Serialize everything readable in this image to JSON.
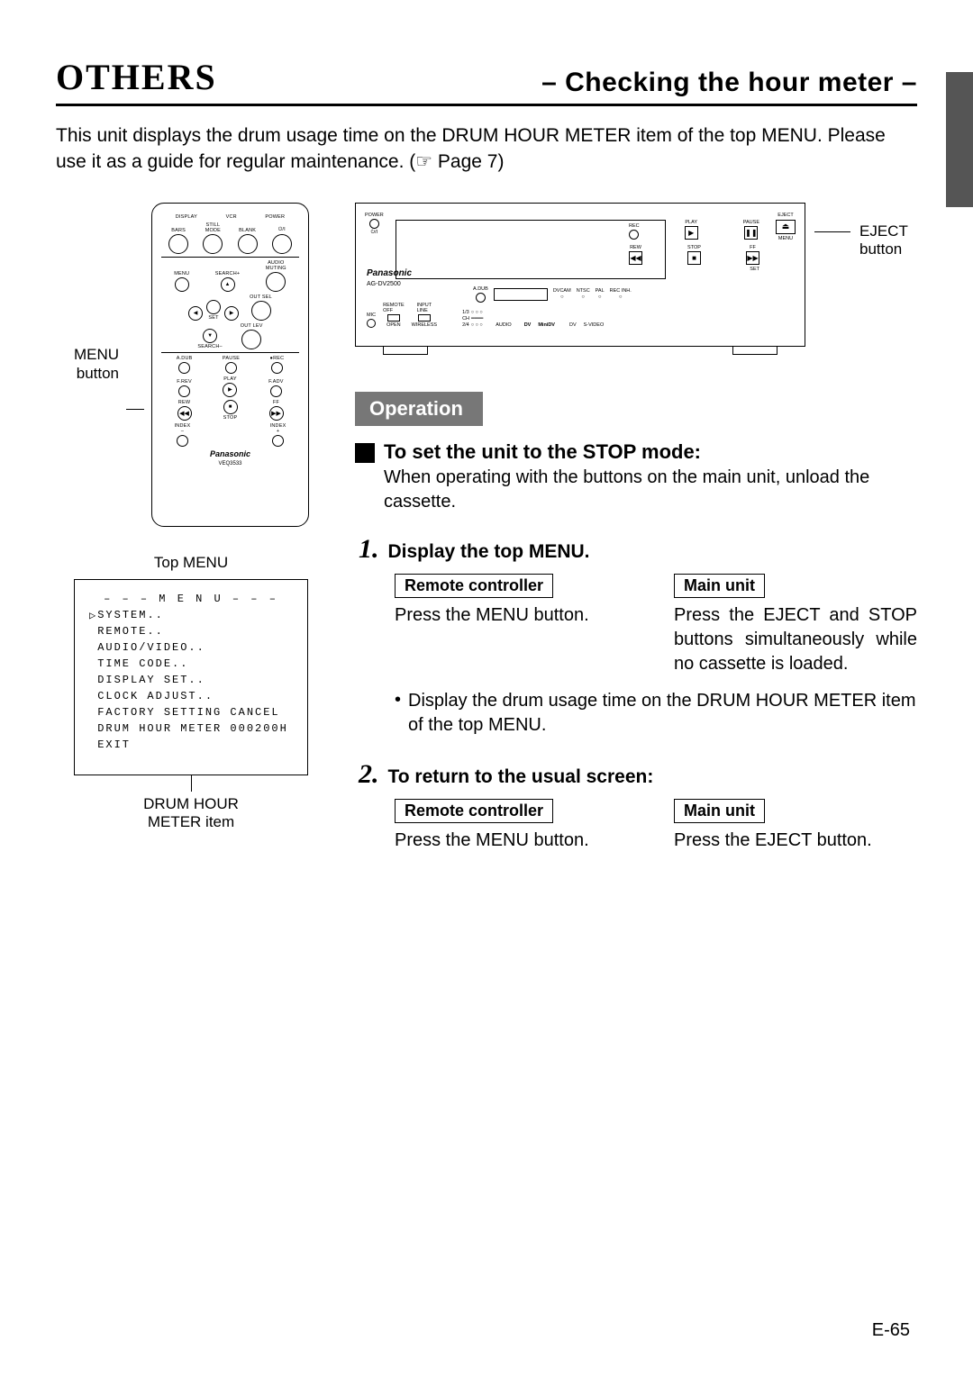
{
  "header": {
    "left": "OTHERS",
    "right": "– Checking the hour meter –"
  },
  "intro": "This unit displays the drum usage time on the DRUM HOUR METER item of the top MENU. Please use it as a guide for regular maintenance. (☞ Page 7)",
  "remote": {
    "side_label": "MENU\nbutton",
    "labels": {
      "display": "DISPLAY",
      "vcr": "VCR",
      "power": "POWER",
      "bars": "BARS",
      "still": "STILL\nMODE",
      "blank": "BLANK",
      "oi": "⏻/I",
      "menu": "MENU",
      "search_plus": "SEARCH+",
      "audio_muting": "AUDIO\nMUTING",
      "set": "SET",
      "out_sel": "OUT SEL",
      "search_minus": "SEARCH–",
      "out_lev": "OUT LEV",
      "adub": "A.DUB",
      "pause": "PAUSE",
      "rec": "REC",
      "frev": "F.REV",
      "play": "PLAY",
      "fadv": "F.ADV",
      "rew": "REW",
      "stop": "STOP",
      "ff": "FF",
      "index_minus": "INDEX\n–",
      "index_plus": "INDEX\n+"
    },
    "brand": "Panasonic",
    "model": "VEQ3533"
  },
  "top_menu": {
    "title": "Top MENU",
    "header": "– – – M E N U – – –",
    "items": [
      "SYSTEM..",
      "REMOTE..",
      "AUDIO/VIDEO..",
      "TIME CODE..",
      "DISPLAY SET..",
      "CLOCK ADJUST..",
      "FACTORY SETTING CANCEL",
      "DRUM HOUR METER 000200H",
      "EXIT"
    ],
    "pointer_label": "DRUM HOUR\nMETER item"
  },
  "deck": {
    "eject_label": "EJECT\nbutton",
    "brand": "Panasonic",
    "model": "AG-DV2500",
    "labels": {
      "power": "POWER",
      "eject": "EJECT",
      "menu": "MENU",
      "oi": "⏻/I",
      "adub": "A.DUB",
      "rec": "REC",
      "play": "PLAY",
      "pause": "PAUSE",
      "rew": "REW",
      "stop": "STOP",
      "ff": "FF",
      "set": "SET",
      "mic": "MIC",
      "remote": "REMOTE\nOFF",
      "input": "INPUT\nLINE",
      "open": "OPEN",
      "wireless": "WIRELESS",
      "dvcam": "DVCAM",
      "ntsc": "NTSC",
      "pal": "PAL",
      "recinh": "REC INH.",
      "ch": "CH",
      "ch13": "1/3",
      "ch24": "2/4",
      "audio": "AUDIO",
      "dv": "DV",
      "minidv": "MiniDV",
      "dv2": "DV",
      "svideo": "S-VIDEO"
    }
  },
  "operation": {
    "badge": "Operation",
    "stop_mode": {
      "title": "To set the unit to the STOP mode:",
      "desc": "When operating with the buttons on the main unit, unload the cassette."
    },
    "steps": [
      {
        "num": "1.",
        "title": "Display the top MENU.",
        "remote_label": "Remote controller",
        "main_label": "Main unit",
        "remote_text": "Press the MENU button.",
        "main_text": "Press the EJECT and STOP buttons simultaneously while no cassette is loaded.",
        "bullet": "Display the drum usage time on the DRUM HOUR METER item of the top MENU."
      },
      {
        "num": "2.",
        "title": "To return to the usual screen:",
        "remote_label": "Remote controller",
        "main_label": "Main unit",
        "remote_text": "Press the MENU button.",
        "main_text": "Press the EJECT button."
      }
    ]
  },
  "page_number": "E-65"
}
